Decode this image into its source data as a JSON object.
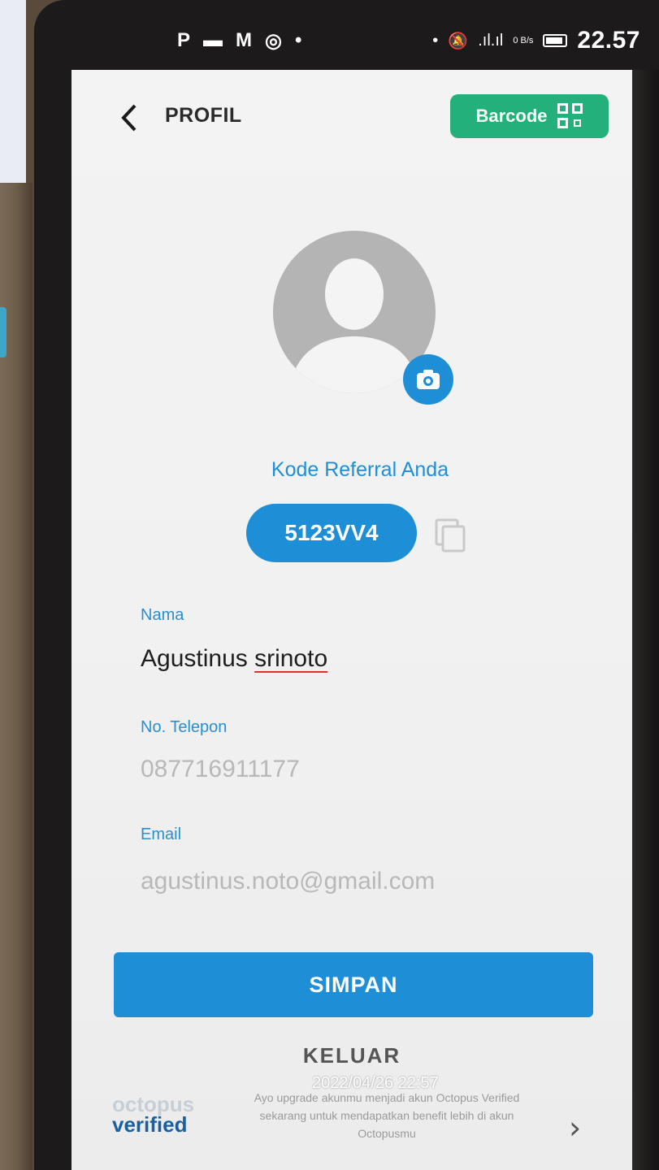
{
  "status_bar": {
    "left_icons": [
      "p-icon",
      "message-icon",
      "gmail-icon",
      "instagram-icon",
      "dot"
    ],
    "time": "22.57",
    "net_speed": "0 B/s"
  },
  "header": {
    "title": "PROFIL",
    "barcode_label": "Barcode"
  },
  "referral": {
    "label": "Kode Referral Anda",
    "code": "5123VV4"
  },
  "form": {
    "nama_label": "Nama",
    "nama_first": "Agustinus ",
    "nama_last": "srinoto",
    "telepon_label": "No. Telepon",
    "telepon_value": "087716911177",
    "email_label": "Email",
    "email_value": "agustinus.noto@gmail.com"
  },
  "actions": {
    "save_label": "SIMPAN",
    "logout_label": "KELUAR"
  },
  "verified_banner": {
    "logo_top": "octopus",
    "logo_bottom": "verified",
    "text": "Ayo upgrade akunmu menjadi akun Octopus Verified sekarang untuk mendapatkan benefit lebih di akun Octopusmu"
  },
  "photo_timestamp": "2022/04/26 22:57",
  "colors": {
    "primary": "#1e8fd6",
    "green": "#23b07a",
    "label": "#2a8fcf",
    "muted": "#b8b8b8"
  }
}
